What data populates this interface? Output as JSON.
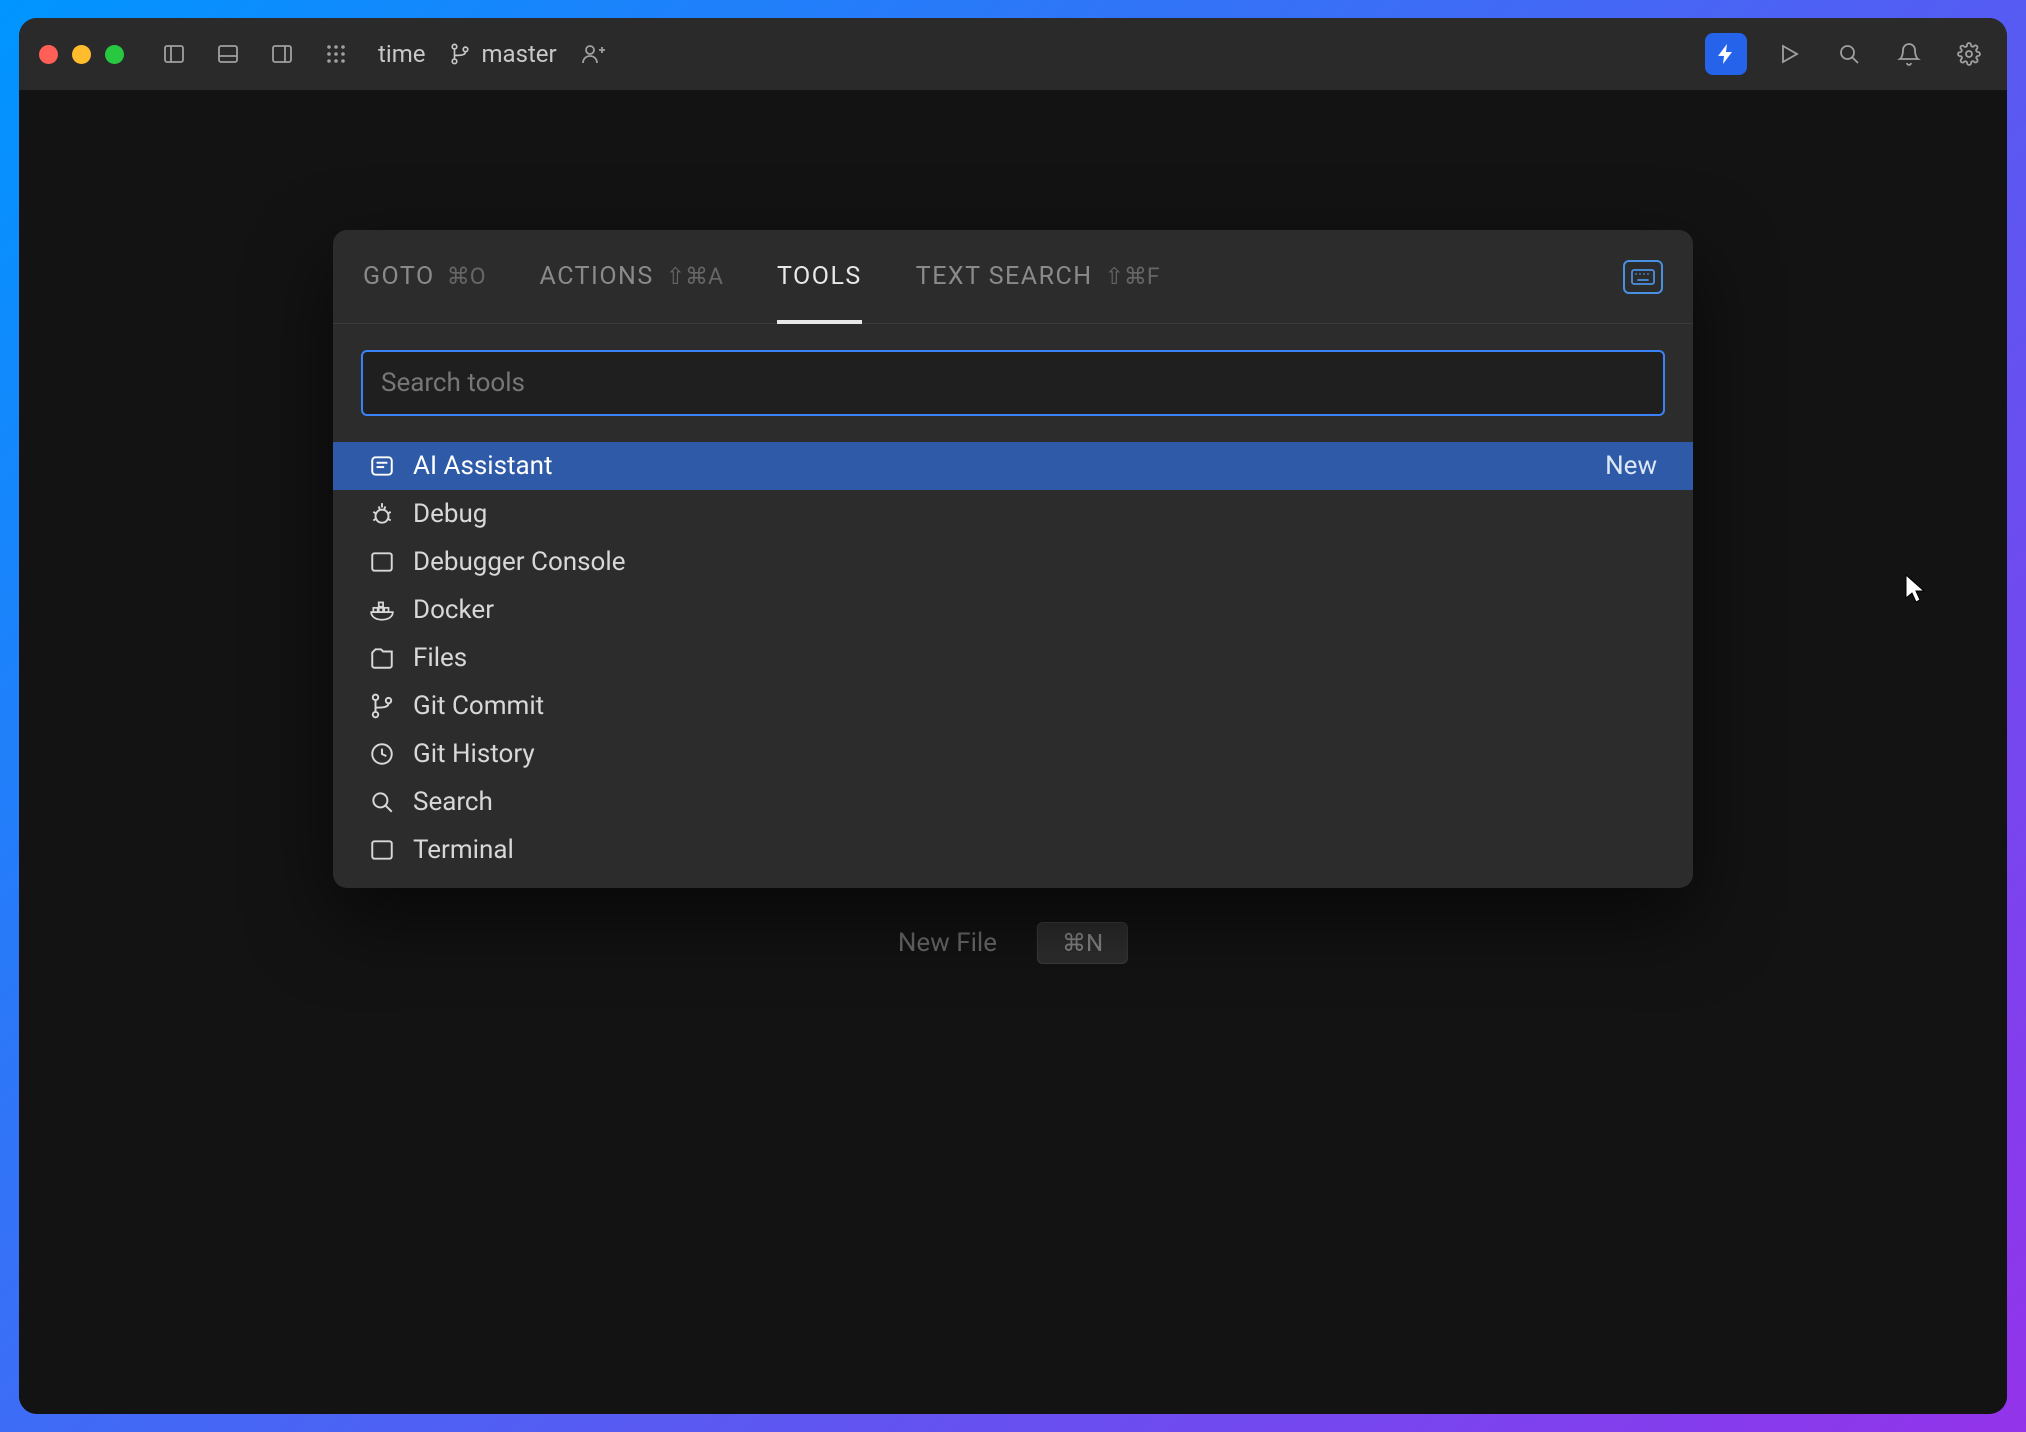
{
  "titlebar": {
    "project_name": "time",
    "branch": "master"
  },
  "palette": {
    "tabs": [
      {
        "label": "GOTO",
        "shortcut": "⌘O",
        "active": false
      },
      {
        "label": "ACTIONS",
        "shortcut": "⇧⌘A",
        "active": false
      },
      {
        "label": "TOOLS",
        "shortcut": "",
        "active": true
      },
      {
        "label": "TEXT SEARCH",
        "shortcut": "⇧⌘F",
        "active": false
      }
    ],
    "search_placeholder": "Search tools",
    "search_value": "",
    "items": [
      {
        "icon": "ai-icon",
        "label": "AI Assistant",
        "badge": "New",
        "selected": true
      },
      {
        "icon": "debug-icon",
        "label": "Debug",
        "badge": "",
        "selected": false
      },
      {
        "icon": "console-icon",
        "label": "Debugger Console",
        "badge": "",
        "selected": false
      },
      {
        "icon": "docker-icon",
        "label": "Docker",
        "badge": "",
        "selected": false
      },
      {
        "icon": "files-icon",
        "label": "Files",
        "badge": "",
        "selected": false
      },
      {
        "icon": "git-commit-icon",
        "label": "Git Commit",
        "badge": "",
        "selected": false
      },
      {
        "icon": "git-history-icon",
        "label": "Git History",
        "badge": "",
        "selected": false
      },
      {
        "icon": "search-icon",
        "label": "Search",
        "badge": "",
        "selected": false
      },
      {
        "icon": "terminal-icon",
        "label": "Terminal",
        "badge": "",
        "selected": false
      }
    ]
  },
  "hint": {
    "label": "New File",
    "shortcut": "⌘N"
  }
}
